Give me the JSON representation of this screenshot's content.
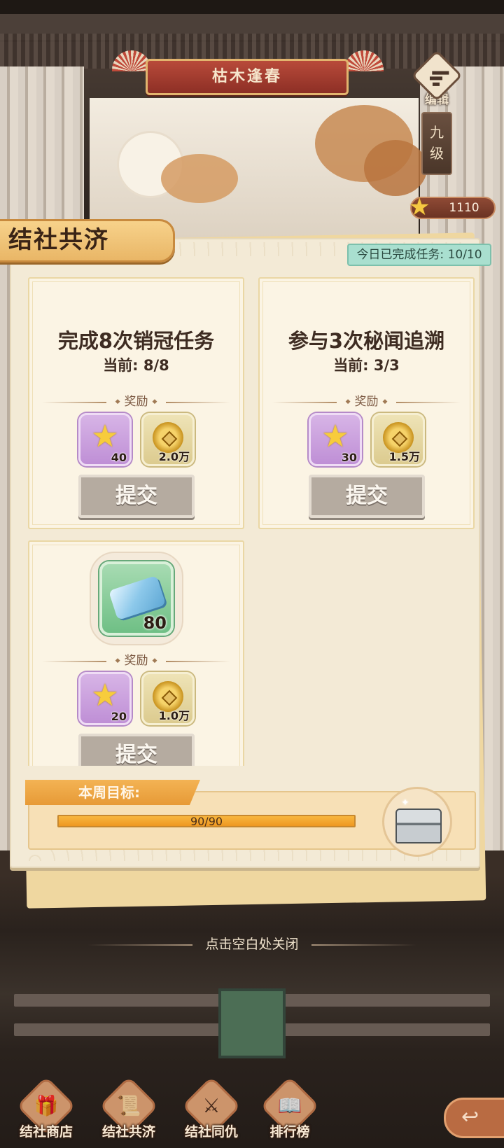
{
  "top": {
    "event_title": "枯木逢春",
    "edit_label": "编辑",
    "level_label": "九级",
    "star_count": "1110"
  },
  "panel": {
    "title": "结社共济",
    "daily_completed": "今日已完成任务: 10/10",
    "reward_label": "奖励",
    "submit_label": "提交"
  },
  "tasks": [
    {
      "title": "完成8次销冠任务",
      "progress": "当前: 8/8",
      "rewards": [
        {
          "icon": "star-icon",
          "amount": "40"
        },
        {
          "icon": "coin-icon",
          "amount": "2.0万"
        }
      ]
    },
    {
      "title": "参与3次秘闻追溯",
      "progress": "当前: 3/3",
      "rewards": [
        {
          "icon": "star-icon",
          "amount": "30"
        },
        {
          "icon": "coin-icon",
          "amount": "1.5万"
        }
      ]
    },
    {
      "item": {
        "icon": "fabric-bolt-icon",
        "amount": "80"
      },
      "rewards": [
        {
          "icon": "star-icon",
          "amount": "20"
        },
        {
          "icon": "coin-icon",
          "amount": "1.0万"
        }
      ]
    }
  ],
  "weekly": {
    "label": "本周目标:",
    "progress_text": "90/90",
    "progress_fraction": 1.0,
    "reward_icon": "treasure-chest-icon"
  },
  "close_hint": "点击空白处关闭",
  "bottom_nav": [
    {
      "label": "结社商店",
      "icon": "shop-gift-icon"
    },
    {
      "label": "结社共济",
      "icon": "scroll-icon"
    },
    {
      "label": "结社同仇",
      "icon": "battle-icon"
    },
    {
      "label": "排行榜",
      "icon": "ranking-book-icon"
    }
  ],
  "back_icon": "back-arrow-icon",
  "colors": {
    "panel_bg": "#f3ead6",
    "header_tab": "#f0c272",
    "daily_badge": "#a9dfcf",
    "progress_fill": "#ee9822",
    "star_reward_bg": "#c99ddb",
    "coin_reward_bg": "#e6d7a2",
    "submit_button": "#b5aba0"
  }
}
